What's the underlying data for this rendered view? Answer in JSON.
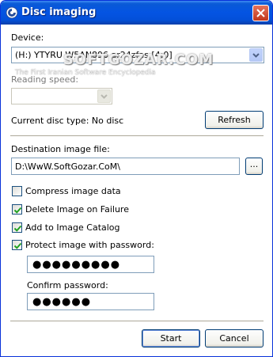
{
  "window": {
    "title": "Disc imaging"
  },
  "watermark": {
    "text": "SOFTGOZAR.COM",
    "subtext": "The First Iranian Software Encyclopedia"
  },
  "device": {
    "label": "Device:",
    "value": "(H:) YTYRU W5AN896 ar24zfas [4:0]"
  },
  "reading_speed": {
    "label": "Reading speed:",
    "value": ""
  },
  "disc_type": {
    "text": "Current disc type: No disc"
  },
  "refresh": {
    "label": "Refresh"
  },
  "destination": {
    "label": "Destination image file:",
    "value": "D:\\WwW.SoftGozar.CoM\\",
    "browse_label": "..."
  },
  "options": [
    {
      "label": "Compress image data",
      "checked": false
    },
    {
      "label": "Delete Image on Failure",
      "checked": true
    },
    {
      "label": "Add to Image Catalog",
      "checked": true
    },
    {
      "label": "Protect image with password:",
      "checked": true
    }
  ],
  "password": {
    "dots": "●●●●●●●●●"
  },
  "confirm": {
    "label": "Confirm password:",
    "dots": "●●●●●●"
  },
  "buttons": {
    "start": "Start",
    "cancel": "Cancel"
  },
  "colors": {
    "titlebar": "#0454e3",
    "border": "#0831d9",
    "close": "#c1371c",
    "check": "#21a121"
  }
}
